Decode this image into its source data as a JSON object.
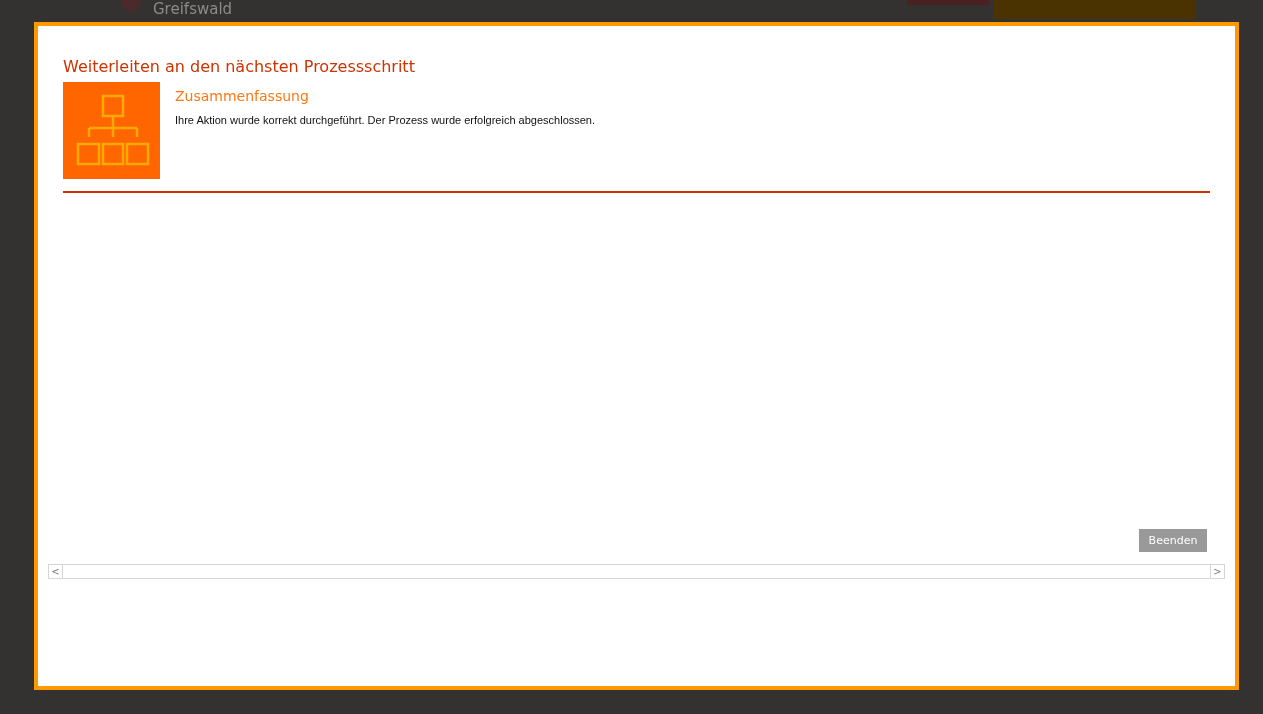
{
  "background_page": {
    "logo_text": "Greifswald"
  },
  "dialog": {
    "title": "Weiterleiten an den nächsten Prozessschritt",
    "section_title": "Zusammenfassung",
    "message": "Ihre Aktion wurde korrekt durchgeführt. Der Prozess wurde erfolgreich abgeschlossen.",
    "buttons": [
      "Beenden"
    ],
    "scrollbar": {
      "left_arrow": "<",
      "right_arrow": ">"
    }
  }
}
